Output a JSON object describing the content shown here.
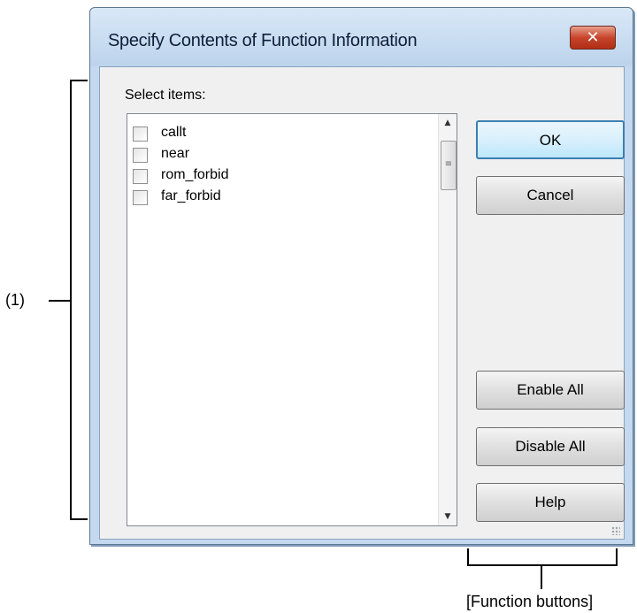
{
  "dialog": {
    "title": "Specify Contents of Function Information",
    "close_label": "✕",
    "select_label": "Select items:",
    "items": [
      {
        "label": "callt",
        "checked": false
      },
      {
        "label": "near",
        "checked": false
      },
      {
        "label": "rom_forbid",
        "checked": false
      },
      {
        "label": "far_forbid",
        "checked": false
      }
    ],
    "buttons": {
      "ok": "OK",
      "cancel": "Cancel",
      "enable_all": "Enable All",
      "disable_all": "Disable All",
      "help": "Help"
    }
  },
  "annotations": {
    "area_1": "(1)",
    "function_buttons": "[Function buttons]"
  }
}
